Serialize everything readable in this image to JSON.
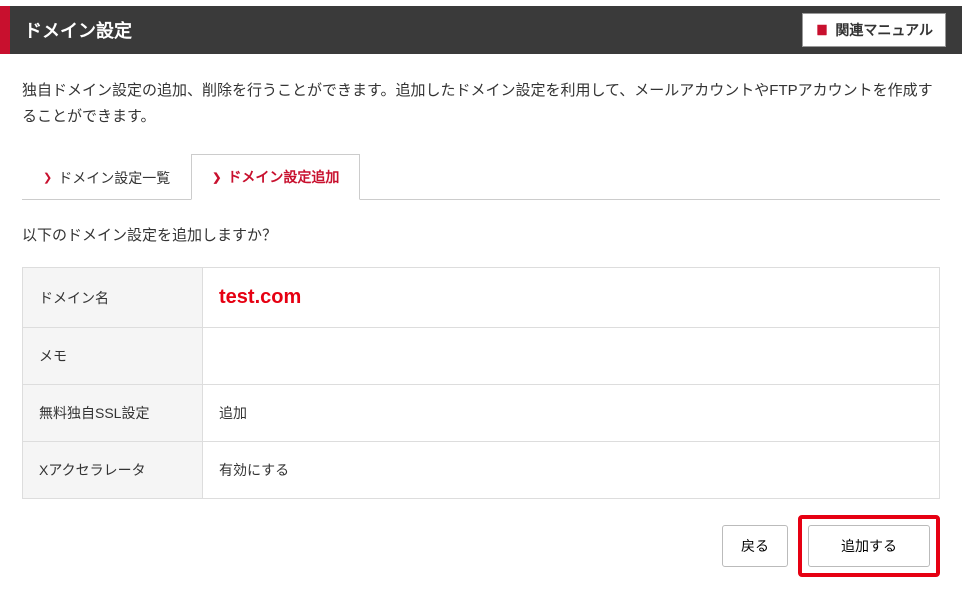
{
  "header": {
    "title": "ドメイン設定",
    "manual_label": "関連マニュアル"
  },
  "intro": "独自ドメイン設定の追加、削除を行うことができます。追加したドメイン設定を利用して、メールアカウントやFTPアカウントを作成することができます。",
  "tabs": {
    "list_label": "ドメイン設定一覧",
    "add_label": "ドメイン設定追加"
  },
  "confirm_text": "以下のドメイン設定を追加しますか？",
  "rows": {
    "domain_label": "ドメイン名",
    "domain_value": "test.com",
    "memo_label": "メモ",
    "memo_value": "",
    "ssl_label": "無料独自SSL設定",
    "ssl_value": "追加",
    "xaccel_label": "Xアクセラレータ",
    "xaccel_value": "有効にする"
  },
  "buttons": {
    "back": "戻る",
    "submit": "追加する"
  }
}
